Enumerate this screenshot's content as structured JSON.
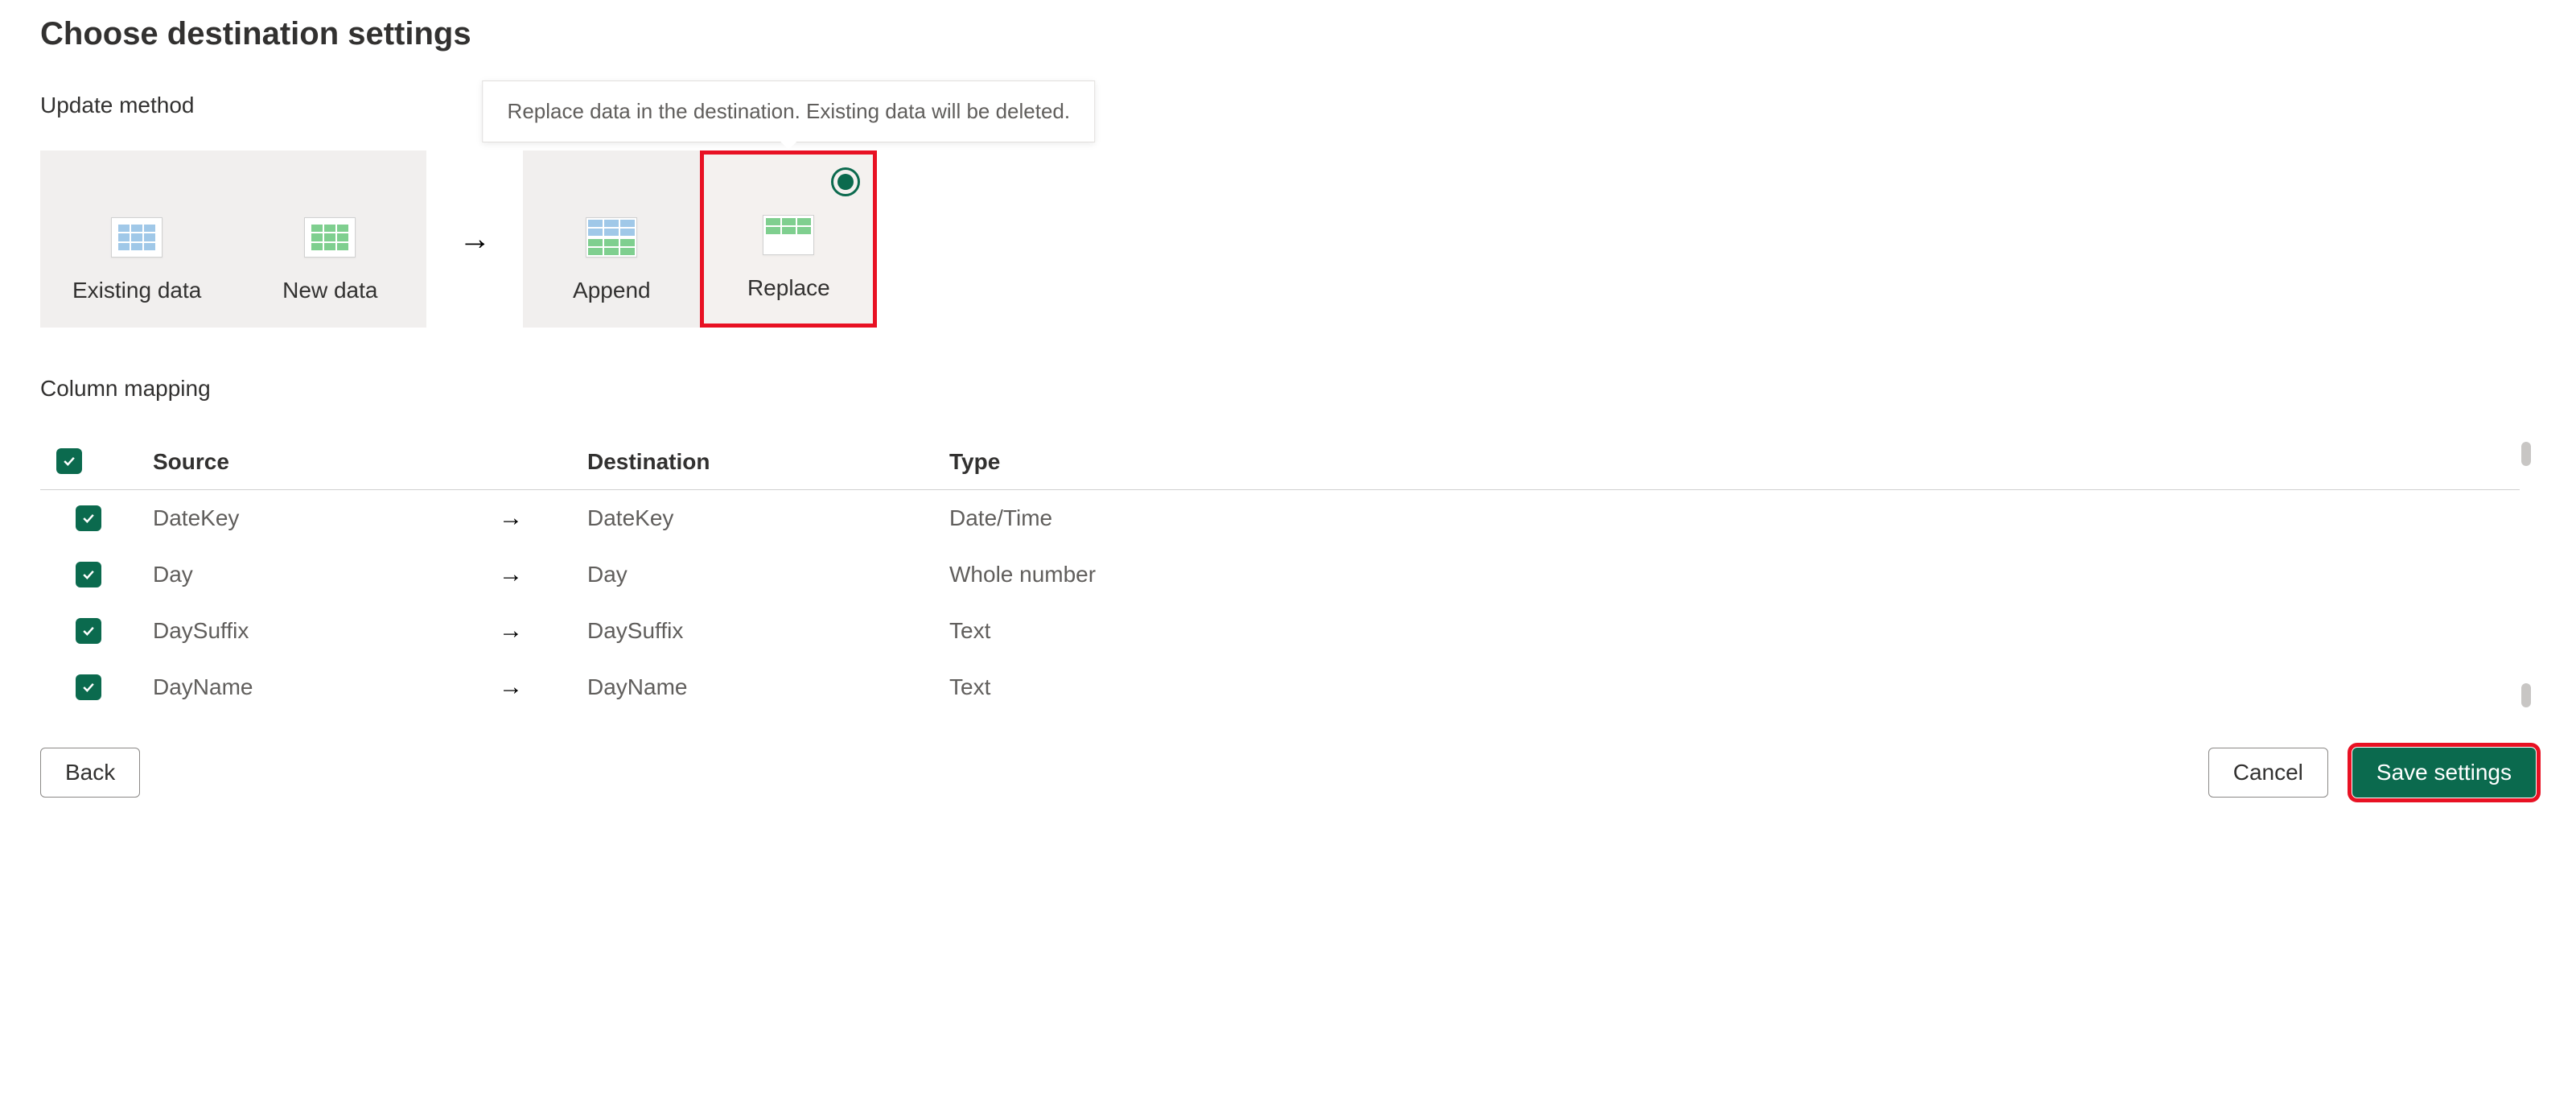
{
  "page": {
    "title": "Choose destination settings"
  },
  "update_method": {
    "heading": "Update method",
    "existing_label": "Existing data",
    "new_label": "New data",
    "append_label": "Append",
    "replace_label": "Replace",
    "tooltip": "Replace data in the destination. Existing data will be deleted.",
    "selected": "Replace"
  },
  "column_mapping": {
    "heading": "Column mapping",
    "headers": {
      "source": "Source",
      "destination": "Destination",
      "type": "Type"
    },
    "rows": [
      {
        "checked": true,
        "source": "DateKey",
        "destination": "DateKey",
        "type": "Date/Time"
      },
      {
        "checked": true,
        "source": "Day",
        "destination": "Day",
        "type": "Whole number"
      },
      {
        "checked": true,
        "source": "DaySuffix",
        "destination": "DaySuffix",
        "type": "Text"
      },
      {
        "checked": true,
        "source": "DayName",
        "destination": "DayName",
        "type": "Text"
      }
    ]
  },
  "buttons": {
    "back": "Back",
    "cancel": "Cancel",
    "save": "Save settings"
  }
}
